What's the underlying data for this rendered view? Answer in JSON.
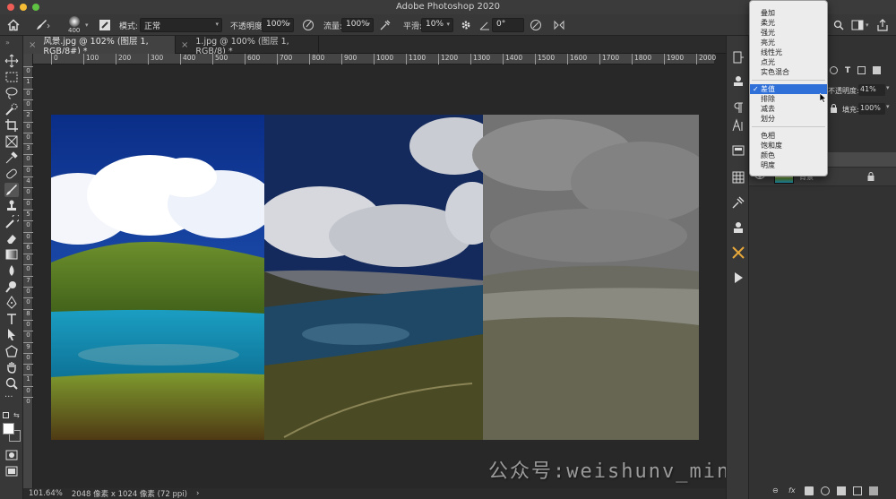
{
  "app_title": "Adobe Photoshop 2020",
  "options_bar": {
    "brush_size": "400",
    "mode_label": "模式:",
    "mode_value": "正常",
    "opacity_label": "不透明度:",
    "opacity_value": "100%",
    "flow_label": "流量:",
    "flow_value": "100%",
    "smoothing_label": "平滑:",
    "smoothing_value": "10%",
    "angle_value": "0°"
  },
  "tabs": [
    {
      "label": "风景.jpg @ 102% (图层 1, RGB/8#) *",
      "active": true
    },
    {
      "label": "1.jpg @ 100% (图层 1, RGB/8) *",
      "active": false
    }
  ],
  "ruler_h": [
    "0",
    "100",
    "200",
    "300",
    "400",
    "500",
    "600",
    "700",
    "800",
    "900",
    "1000",
    "1100",
    "1200",
    "1300",
    "1400",
    "1500",
    "1600",
    "1700",
    "1800",
    "1900",
    "2000"
  ],
  "ruler_v": [
    "0",
    "1",
    "0",
    "0",
    "2",
    "0",
    "0",
    "3",
    "0",
    "0",
    "4",
    "0",
    "0",
    "5",
    "0",
    "0",
    "6",
    "0",
    "0",
    "7",
    "0",
    "0",
    "8",
    "0",
    "0",
    "9",
    "0",
    "0",
    "1",
    "0",
    "0"
  ],
  "status": {
    "zoom": "101.64%",
    "doc_info": "2048 像素 x 1024 像素 (72 ppi)",
    "arrow": "›"
  },
  "layers_panel": {
    "opacity_label": "不透明度:",
    "opacity_value": "41%",
    "fill_label": "填充:",
    "fill_value": "100%",
    "background_layer": "背景"
  },
  "blend_menu": {
    "items": [
      {
        "label": "叠加",
        "group": 0
      },
      {
        "label": "柔光",
        "group": 0
      },
      {
        "label": "强光",
        "group": 0
      },
      {
        "label": "亮光",
        "group": 0
      },
      {
        "label": "线性光",
        "group": 0
      },
      {
        "label": "点光",
        "group": 0
      },
      {
        "label": "实色混合",
        "group": 0
      },
      {
        "label": "差值",
        "group": 1,
        "selected": true
      },
      {
        "label": "排除",
        "group": 1
      },
      {
        "label": "减去",
        "group": 1
      },
      {
        "label": "划分",
        "group": 1
      },
      {
        "label": "色相",
        "group": 2
      },
      {
        "label": "饱和度",
        "group": 2
      },
      {
        "label": "颜色",
        "group": 2
      },
      {
        "label": "明度",
        "group": 2
      }
    ],
    "check": "✓"
  },
  "watermark": {
    "line1": "公众号:weishunv_min"
  },
  "colors": {
    "menu_highlight": "#2e6fd8",
    "ui_dark": "#282828",
    "panel": "#323232"
  }
}
